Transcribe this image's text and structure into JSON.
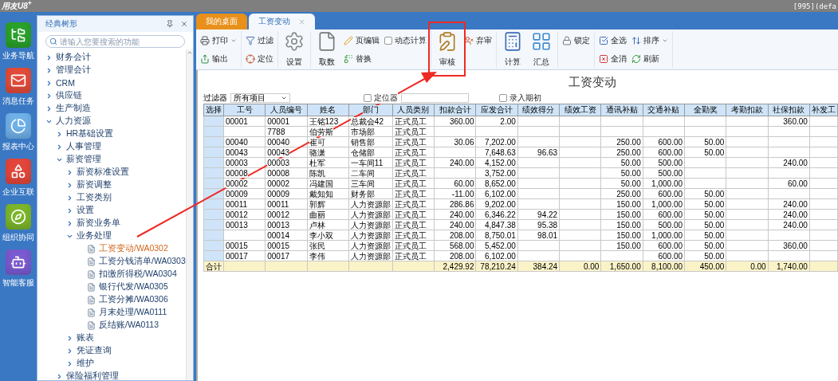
{
  "topbar": {
    "logo": "用友U8$^{+}$",
    "session": "[995](defa"
  },
  "rail": [
    {
      "label": "业务导航"
    },
    {
      "label": "消息任务"
    },
    {
      "label": "报表中心"
    },
    {
      "label": "企业互联"
    },
    {
      "label": "组织协同"
    },
    {
      "label": "智能客服"
    }
  ],
  "sidebar": {
    "title": "经典树形",
    "search": {
      "placeholder": "请输入您要搜索的功能"
    },
    "tree": [
      {
        "label": "财务会计",
        "kind": "folder",
        "expanded": false
      },
      {
        "label": "管理会计",
        "kind": "folder",
        "expanded": false
      },
      {
        "label": "CRM",
        "kind": "folder",
        "expanded": false
      },
      {
        "label": "供应链",
        "kind": "folder",
        "expanded": false
      },
      {
        "label": "生产制造",
        "kind": "folder",
        "expanded": false
      },
      {
        "label": "人力资源",
        "kind": "folder",
        "expanded": true,
        "children": [
          {
            "label": "HR基础设置",
            "kind": "folder",
            "expanded": false
          },
          {
            "label": "人事管理",
            "kind": "folder",
            "expanded": false
          },
          {
            "label": "薪资管理",
            "kind": "folder",
            "expanded": true,
            "children": [
              {
                "label": "薪资标准设置",
                "kind": "folder",
                "expanded": false
              },
              {
                "label": "薪资调整",
                "kind": "folder",
                "expanded": false
              },
              {
                "label": "工资类别",
                "kind": "folder",
                "expanded": false
              },
              {
                "label": "设置",
                "kind": "folder",
                "expanded": false
              },
              {
                "label": "薪资业务单",
                "kind": "folder",
                "expanded": false
              },
              {
                "label": "业务处理",
                "kind": "folder",
                "expanded": true,
                "children": [
                  {
                    "label": "工资变动/WA0302",
                    "kind": "page",
                    "selected": true
                  },
                  {
                    "label": "工资分钱清单/WA0303",
                    "kind": "page",
                    "selected": false
                  },
                  {
                    "label": "扣缴所得税/WA0304",
                    "kind": "page",
                    "selected": false
                  },
                  {
                    "label": "银行代发/WA0305",
                    "kind": "page",
                    "selected": false
                  },
                  {
                    "label": "工资分摊/WA0306",
                    "kind": "page",
                    "selected": false
                  },
                  {
                    "label": "月末处理/WA0111",
                    "kind": "page",
                    "selected": false
                  },
                  {
                    "label": "反结账/WA0113",
                    "kind": "page",
                    "selected": false
                  }
                ]
              },
              {
                "label": "账表",
                "kind": "folder",
                "expanded": false
              },
              {
                "label": "凭证查询",
                "kind": "folder",
                "expanded": false
              },
              {
                "label": "维护",
                "kind": "folder",
                "expanded": false
              }
            ]
          },
          {
            "label": "保险福利管理",
            "kind": "folder",
            "expanded": false
          }
        ]
      }
    ]
  },
  "tabs": [
    {
      "label": "我的桌面",
      "selected": false,
      "closable": false
    },
    {
      "label": "工资变动",
      "selected": true,
      "closable": true
    }
  ],
  "toolbar": [
    {
      "items": [
        {
          "label": "打印",
          "kind": "small",
          "menu": true
        },
        {
          "label": "输出",
          "kind": "small",
          "menu": false
        }
      ]
    },
    {
      "items": [
        {
          "label": "过滤",
          "kind": "small",
          "menu": false
        },
        {
          "label": "定位",
          "kind": "small",
          "menu": false
        }
      ]
    },
    {
      "items": [
        {
          "label": "设置",
          "kind": "large"
        }
      ]
    },
    {
      "items": [
        {
          "label": "取数",
          "kind": "large"
        },
        {
          "label": "页编辑",
          "kind": "small",
          "menu": false
        },
        {
          "label": "替换",
          "kind": "small",
          "menu": false
        },
        {
          "label": "动态计算",
          "kind": "check",
          "checked": false
        }
      ]
    },
    {
      "items": [
        {
          "label": "审核",
          "kind": "large"
        },
        {
          "label": "弃审",
          "kind": "small",
          "menu": false
        }
      ]
    },
    {
      "items": [
        {
          "label": "计算",
          "kind": "large"
        },
        {
          "label": "汇总",
          "kind": "large"
        }
      ]
    },
    {
      "items": [
        {
          "label": "锁定",
          "kind": "small",
          "menu": false
        }
      ]
    },
    {
      "items": [
        {
          "label": "全选",
          "kind": "small",
          "menu": false
        },
        {
          "label": "全消",
          "kind": "small",
          "menu": false
        },
        {
          "label": "排序",
          "kind": "small",
          "menu": true
        },
        {
          "label": "刷新",
          "kind": "small",
          "menu": false
        }
      ]
    }
  ],
  "page_title": "工资变动",
  "filter": {
    "label": "过滤器",
    "value": "所有项目",
    "locator": {
      "label": "定位器",
      "checked": false
    },
    "opening": {
      "label": "录入期初",
      "checked": false
    }
  },
  "table": {
    "columns": [
      "选择",
      "工号",
      "人员编号",
      "姓名",
      "部门",
      "人员类别",
      "扣款合计",
      "应发合计",
      "绩效得分",
      "绩效工资",
      "通讯补贴",
      "交通补贴",
      "全勤奖",
      "考勤扣款",
      "社保扣款",
      "补发工"
    ],
    "rows": [
      {
        "cells": [
          "",
          "00001",
          "00001",
          "王铭123",
          "总裁会42",
          "正式员工",
          "360.00",
          "2.00",
          "",
          "",
          "",
          "",
          "",
          "",
          "360.00",
          ""
        ]
      },
      {
        "cells": [
          "",
          "",
          "7788",
          "伯劳斯",
          "市场部",
          "正式员工",
          "",
          "",
          "",
          "",
          "",
          "",
          "",
          "",
          "",
          ""
        ]
      },
      {
        "cells": [
          "",
          "00040",
          "00040",
          "崔可",
          "销售部",
          "正式员工",
          "30.06",
          "7,202.00",
          "",
          "",
          "250.00",
          "600.00",
          "50.00",
          "",
          "",
          ""
        ]
      },
      {
        "cells": [
          "",
          "00043",
          "00043",
          "骆潇",
          "仓储部",
          "正式员工",
          "",
          "7,648.63",
          "96.63",
          "",
          "250.00",
          "600.00",
          "50.00",
          "",
          "",
          ""
        ]
      },
      {
        "cells": [
          "",
          "00003",
          "00003",
          "杜军",
          "一车间11",
          "正式员工",
          "240.00",
          "4,152.00",
          "",
          "",
          "50.00",
          "500.00",
          "",
          "",
          "240.00",
          ""
        ]
      },
      {
        "cells": [
          "",
          "00008",
          "00008",
          "陈凯",
          "二车间",
          "正式员工",
          "",
          "3,752.00",
          "",
          "",
          "50.00",
          "500.00",
          "",
          "",
          "",
          ""
        ]
      },
      {
        "cells": [
          "",
          "00002",
          "00002",
          "冯建国",
          "三车间",
          "正式员工",
          "60.00",
          "8,652.00",
          "",
          "",
          "50.00",
          "1,000.00",
          "",
          "",
          "60.00",
          ""
        ]
      },
      {
        "cells": [
          "",
          "00009",
          "00009",
          "戴知知",
          "财务部",
          "正式员工",
          "-11.00",
          "6,102.00",
          "",
          "",
          "250.00",
          "600.00",
          "50.00",
          "",
          "",
          ""
        ]
      },
      {
        "cells": [
          "",
          "00011",
          "00011",
          "郭辉",
          "人力资源部",
          "正式员工",
          "286.86",
          "9,202.00",
          "",
          "",
          "150.00",
          "1,000.00",
          "50.00",
          "",
          "240.00",
          ""
        ]
      },
      {
        "cells": [
          "",
          "00012",
          "00012",
          "曲丽",
          "人力资源部",
          "正式员工",
          "240.00",
          "6,346.22",
          "94.22",
          "",
          "150.00",
          "600.00",
          "50.00",
          "",
          "240.00",
          ""
        ]
      },
      {
        "cells": [
          "",
          "00013",
          "00013",
          "卢林",
          "人力资源部",
          "正式员工",
          "240.00",
          "4,847.38",
          "95.38",
          "",
          "150.00",
          "500.00",
          "50.00",
          "",
          "240.00",
          ""
        ]
      },
      {
        "cells": [
          "",
          "",
          "00014",
          "李小双",
          "人力资源部",
          "正式员工",
          "208.00",
          "8,750.01",
          "98.01",
          "",
          "150.00",
          "1,000.00",
          "50.00",
          "",
          "",
          ""
        ]
      },
      {
        "cells": [
          "",
          "00015",
          "00015",
          "张民",
          "人力资源部",
          "正式员工",
          "568.00",
          "5,452.00",
          "",
          "",
          "150.00",
          "600.00",
          "50.00",
          "",
          "360.00",
          ""
        ]
      },
      {
        "cells": [
          "",
          "00017",
          "00017",
          "李伟",
          "人力资源部",
          "正式员工",
          "208.00",
          "6,102.00",
          "",
          "",
          "",
          "600.00",
          "50.00",
          "",
          "",
          ""
        ]
      }
    ],
    "total": {
      "cells": [
        "合计",
        "",
        "",
        "",
        "",
        "",
        "2,429.92",
        "78,210.24",
        "384.24",
        "0.00",
        "1,650.00",
        "8,100.00",
        "450.00",
        "0.00",
        "1,740.00",
        ""
      ]
    }
  }
}
